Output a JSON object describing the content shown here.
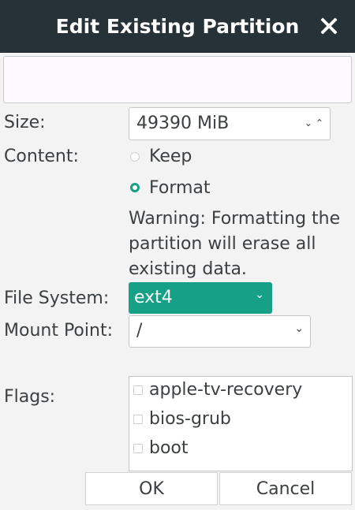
{
  "dialog": {
    "title": "Edit Existing Partition"
  },
  "name_entry": {
    "value": ""
  },
  "size": {
    "label": "Size:",
    "value": "49390 MiB"
  },
  "content": {
    "label": "Content:",
    "options": [
      {
        "label": "Keep",
        "checked": false
      },
      {
        "label": "Format",
        "checked": true
      }
    ],
    "warning": [
      "Warning: Formatting the",
      "partition will erase all",
      "existing data."
    ]
  },
  "file_system": {
    "label": "File System:",
    "value": "ext4"
  },
  "mount_point": {
    "label": "Mount Point:",
    "value": "/"
  },
  "flags": {
    "label": "Flags:",
    "items": [
      {
        "label": "apple-tv-recovery",
        "checked": false
      },
      {
        "label": "bios-grub",
        "checked": false
      },
      {
        "label": "boot",
        "checked": false
      }
    ]
  },
  "buttons": {
    "ok": "OK",
    "cancel": "Cancel"
  },
  "colors": {
    "titlebar": "#263238",
    "accent": "#16a085"
  },
  "icons": {
    "close": "close-icon",
    "spin": "spin-arrows-icon",
    "dropdown": "chevron-down-icon"
  }
}
